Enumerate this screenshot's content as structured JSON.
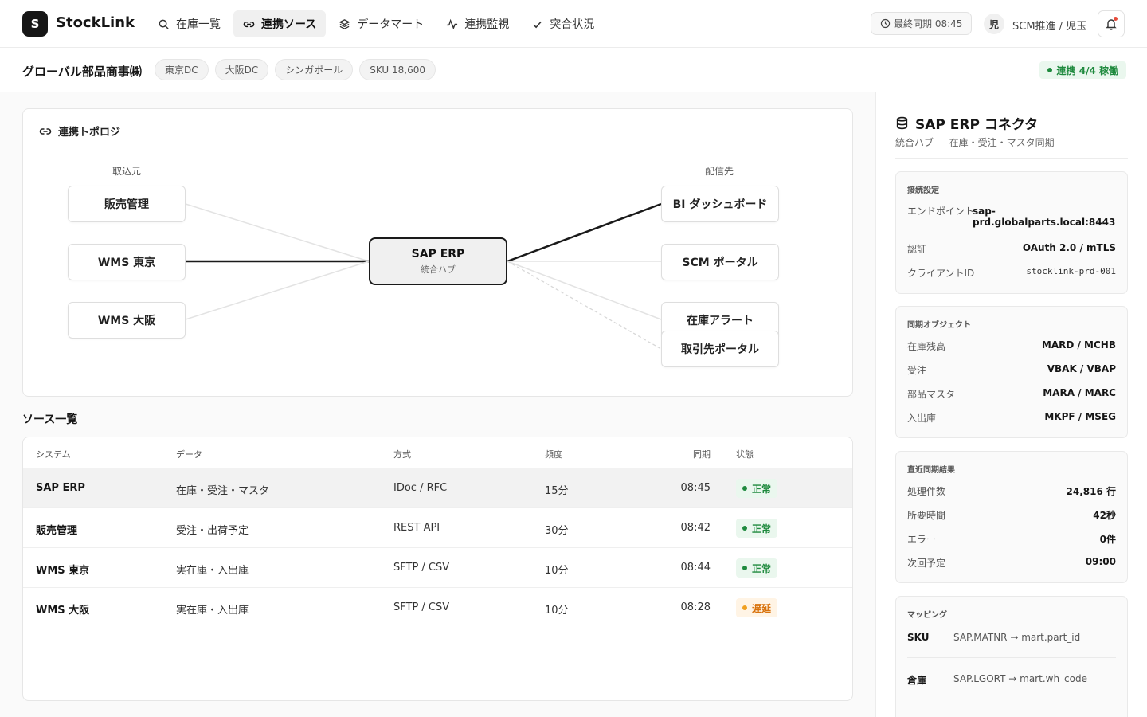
{
  "app": {
    "logo_letter": "S",
    "brand": "StockLink"
  },
  "nav": [
    {
      "label": "在庫一覧",
      "icon": "search-icon"
    },
    {
      "label": "連携ソース",
      "icon": "link-icon",
      "active": true
    },
    {
      "label": "データマート",
      "icon": "layers-icon"
    },
    {
      "label": "連携監視",
      "icon": "activity-icon"
    },
    {
      "label": "突合状況",
      "icon": "check-icon"
    }
  ],
  "header": {
    "last_sync": "最終同期 08:45",
    "avatar_initial": "児",
    "user": "SCM推進 / 児玉"
  },
  "subheader": {
    "company": "グローバル部品商事㈱",
    "chips": [
      "東京DC",
      "大阪DC",
      "シンガポール",
      "SKU 18,600"
    ],
    "status": "連携 4/4 稼働"
  },
  "topology": {
    "title": "連携トポロジ",
    "sources_label": "取込元",
    "targets_label": "配信先",
    "sources": [
      "販売管理",
      "WMS 東京",
      "WMS 大阪"
    ],
    "hub_title": "SAP ERP",
    "hub_sub": "統合ハブ",
    "targets": [
      "BI ダッシュボード",
      "SCM ポータル",
      "在庫アラート",
      "取引先ポータル"
    ]
  },
  "sources_table": {
    "title": "ソース一覧",
    "headers": [
      "システム",
      "データ",
      "方式",
      "頻度",
      "同期",
      "状態"
    ],
    "rows": [
      {
        "system": "SAP ERP",
        "data": "在庫・受注・マスタ",
        "method": "IDoc / RFC",
        "freq": "15分",
        "sync": "08:45",
        "state": "正常",
        "state_type": "ok"
      },
      {
        "system": "販売管理",
        "data": "受注・出荷予定",
        "method": "REST API",
        "freq": "30分",
        "sync": "08:42",
        "state": "正常",
        "state_type": "ok"
      },
      {
        "system": "WMS 東京",
        "data": "実在庫・入出庫",
        "method": "SFTP / CSV",
        "freq": "10分",
        "sync": "08:44",
        "state": "正常",
        "state_type": "ok"
      },
      {
        "system": "WMS 大阪",
        "data": "実在庫・入出庫",
        "method": "SFTP / CSV",
        "freq": "10分",
        "sync": "08:28",
        "state": "遅延",
        "state_type": "warn"
      }
    ]
  },
  "panel": {
    "title": "SAP ERP コネクタ",
    "subtitle": "統合ハブ — 在庫・受注・マスタ同期",
    "connection": {
      "label": "接続設定",
      "endpoint_key": "エンドポイント",
      "endpoint_val": "sap-prd.globalparts.local:8443",
      "auth_key": "認証",
      "auth_val": "OAuth 2.0 / mTLS",
      "client_key": "クライアントID",
      "client_val": "stocklink-prd-001"
    },
    "objects": {
      "label": "同期オブジェクト",
      "items": [
        {
          "k": "在庫残高",
          "v": "MARD / MCHB"
        },
        {
          "k": "受注",
          "v": "VBAK / VBAP"
        },
        {
          "k": "部品マスタ",
          "v": "MARA / MARC"
        },
        {
          "k": "入出庫",
          "v": "MKPF / MSEG"
        }
      ]
    },
    "results": {
      "label": "直近同期結果",
      "items": [
        {
          "k": "処理件数",
          "v": "24,816 行"
        },
        {
          "k": "所要時間",
          "v": "42秒"
        },
        {
          "k": "エラー",
          "v": "0件"
        },
        {
          "k": "次回予定",
          "v": "09:00"
        }
      ]
    },
    "mapping": {
      "label": "マッピング",
      "items": [
        {
          "k": "SKU",
          "v": "SAP.MATNR → mart.part_id"
        },
        {
          "k": "倉庫",
          "v": "SAP.LGORT → mart.wh_code"
        }
      ]
    }
  }
}
